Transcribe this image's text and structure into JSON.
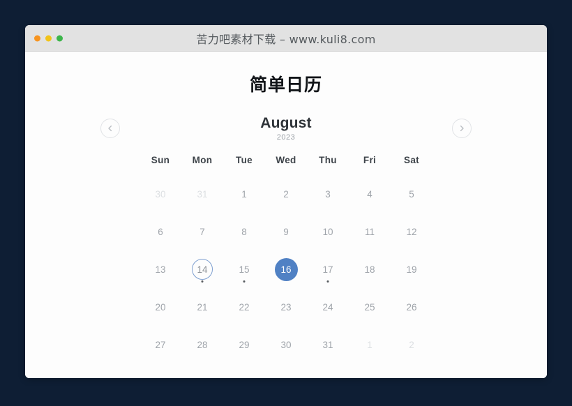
{
  "window": {
    "title": "苦力吧素材下载 – www.kuli8.com",
    "traffic_lights": [
      "close-red",
      "minimize-yellow",
      "maximize-green"
    ]
  },
  "page": {
    "title": "简单日历"
  },
  "calendar": {
    "prev_label": "chevron-left",
    "next_label": "chevron-right",
    "month": "August",
    "year": "2023",
    "weekdays": [
      "Sun",
      "Mon",
      "Tue",
      "Wed",
      "Thu",
      "Fri",
      "Sat"
    ],
    "accent_color": "#5081c4",
    "days": [
      {
        "n": "30",
        "other": true
      },
      {
        "n": "31",
        "other": true
      },
      {
        "n": "1"
      },
      {
        "n": "2"
      },
      {
        "n": "3"
      },
      {
        "n": "4"
      },
      {
        "n": "5"
      },
      {
        "n": "6"
      },
      {
        "n": "7"
      },
      {
        "n": "8"
      },
      {
        "n": "9"
      },
      {
        "n": "10"
      },
      {
        "n": "11"
      },
      {
        "n": "12"
      },
      {
        "n": "13"
      },
      {
        "n": "14",
        "today": true,
        "dot": true
      },
      {
        "n": "15",
        "dot": true
      },
      {
        "n": "16",
        "selected": true
      },
      {
        "n": "17",
        "dot": true
      },
      {
        "n": "18"
      },
      {
        "n": "19"
      },
      {
        "n": "20"
      },
      {
        "n": "21"
      },
      {
        "n": "22"
      },
      {
        "n": "23"
      },
      {
        "n": "24"
      },
      {
        "n": "25"
      },
      {
        "n": "26"
      },
      {
        "n": "27"
      },
      {
        "n": "28"
      },
      {
        "n": "29"
      },
      {
        "n": "30"
      },
      {
        "n": "31"
      },
      {
        "n": "1",
        "other": true
      },
      {
        "n": "2",
        "other": true
      }
    ]
  }
}
